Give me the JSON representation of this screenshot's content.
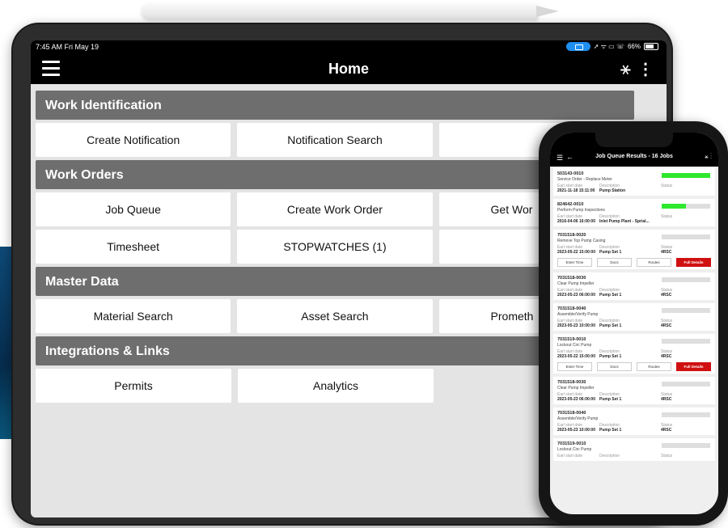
{
  "status": {
    "time": "7:45 AM  Fri May 19",
    "battery": "66%"
  },
  "header": {
    "title": "Home"
  },
  "sections": [
    {
      "title": "Work Identification",
      "rows": [
        [
          "Create Notification",
          "Notification Search"
        ]
      ]
    },
    {
      "title": "Work Orders",
      "rows": [
        [
          "Job Queue",
          "Create Work Order",
          "Get Wor"
        ],
        [
          "Timesheet",
          "STOPWATCHES (1)"
        ]
      ]
    },
    {
      "title": "Master Data",
      "rows": [
        [
          "Material Search",
          "Asset Search",
          "Prometh"
        ]
      ]
    },
    {
      "title": "Integrations & Links",
      "rows": [
        [
          "Permits",
          "Analytics"
        ]
      ]
    }
  ],
  "phone": {
    "title": "Job Queue Results - 16 Jobs",
    "labels": {
      "start": "Earl start date",
      "desc": "Description",
      "status": "Status"
    },
    "actions": [
      "Enter Time",
      "Docs",
      "Routes",
      "Full Details"
    ],
    "jobs": [
      {
        "num": "503143-0010",
        "desc": "Service Order - Replace Meter",
        "date": "2021-11-18 15:11:00",
        "location": "Pump Station",
        "status": "",
        "progress": 1.0,
        "actions": false
      },
      {
        "num": "824642-0010",
        "desc": "Perform Pump Inspections",
        "date": "2016-04-06 16:00:00",
        "location": "Inlet Pump Plant - Sprial...",
        "status": "",
        "progress": 0.5,
        "actions": false
      },
      {
        "num": "7031518-0020",
        "desc": "Remove Top Pump Casing",
        "date": "2023-05-22 15:00:00",
        "location": "Pump Set 1",
        "status": "4RSC",
        "progress": 0,
        "actions": true
      },
      {
        "num": "7031518-0030",
        "desc": "Clear Pump Impeller",
        "date": "2023-05-23 06:00:00",
        "location": "Pump Set 1",
        "status": "4RSC",
        "progress": 0,
        "actions": false
      },
      {
        "num": "7031518-0040",
        "desc": "Assemble/Verify Pump",
        "date": "2023-05-23 10:00:00",
        "location": "Pump Set 1",
        "status": "4RSC",
        "progress": 0,
        "actions": false
      },
      {
        "num": "7031519-0010",
        "desc": "Lockout Circ Pump",
        "date": "2023-05-22 15:00:00",
        "location": "Pump Set 1",
        "status": "4RSC",
        "progress": 0,
        "actions": true
      },
      {
        "num": "7031518-0030",
        "desc": "Clear Pump Impeller",
        "date": "2023-05-23 06:00:00",
        "location": "Pump Set 1",
        "status": "4RSC",
        "progress": 0,
        "actions": false
      },
      {
        "num": "7031518-0040",
        "desc": "Assemble/Verify Pump",
        "date": "2023-05-23 10:00:00",
        "location": "Pump Set 1",
        "status": "4RSC",
        "progress": 0,
        "actions": false
      },
      {
        "num": "7031519-0010",
        "desc": "Lockout Circ Pump",
        "date": "",
        "location": "",
        "status": "",
        "progress": 0,
        "actions": false
      }
    ]
  }
}
